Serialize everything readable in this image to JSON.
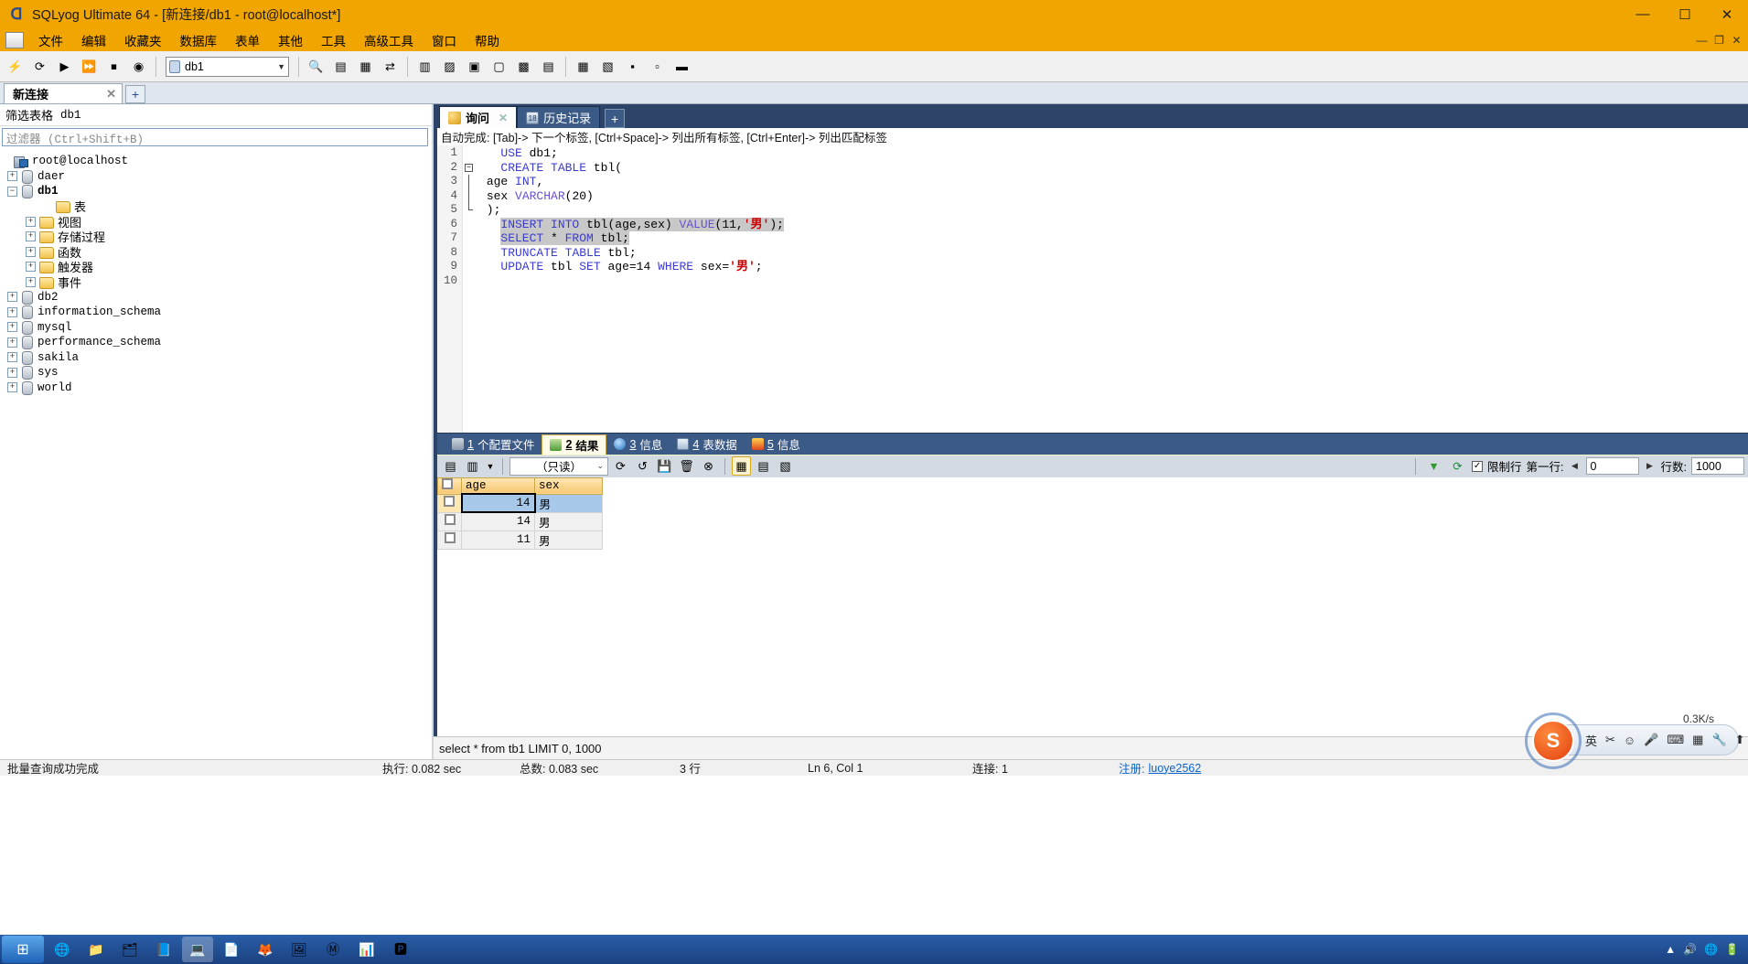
{
  "window": {
    "title": "SQLyog Ultimate 64 - [新连接/db1 - root@localhost*]",
    "minimize": "—",
    "maximize": "☐",
    "close": "✕"
  },
  "menubar": {
    "items": [
      "文件",
      "编辑",
      "收藏夹",
      "数据库",
      "表单",
      "其他",
      "工具",
      "高级工具",
      "窗口",
      "帮助"
    ],
    "mdi_minimize": "—",
    "mdi_restore": "❐",
    "mdi_close": "✕"
  },
  "toolbar": {
    "db_selector_value": "db1",
    "db_selector_arrow": "▼",
    "buttons": [
      {
        "name": "new-connection",
        "glyph": "⚡"
      },
      {
        "name": "refresh-object-browser",
        "glyph": "⟳"
      },
      {
        "name": "execute-query",
        "glyph": "▶"
      },
      {
        "name": "execute-all-queries",
        "glyph": "⏩"
      },
      {
        "name": "stop-query",
        "glyph": "⏹"
      },
      {
        "name": "firefox-like",
        "glyph": "◉"
      },
      {
        "name": "find",
        "glyph": "🔍"
      },
      {
        "name": "query-builder",
        "glyph": "▤"
      },
      {
        "name": "schema-designer",
        "glyph": "▦"
      },
      {
        "name": "data-sync",
        "glyph": "⇄"
      },
      {
        "name": "table-data",
        "glyph": "▥"
      },
      {
        "name": "table-diagnostics",
        "glyph": "▨"
      },
      {
        "name": "backup",
        "glyph": "▣"
      },
      {
        "name": "restore",
        "glyph": "▢"
      },
      {
        "name": "import-external",
        "glyph": "▩"
      },
      {
        "name": "export-csv",
        "glyph": "▤"
      },
      {
        "name": "scheduler",
        "glyph": "▦"
      },
      {
        "name": "user-manager",
        "glyph": "▧"
      },
      {
        "name": "preferences",
        "glyph": "▪"
      },
      {
        "name": "help-tools",
        "glyph": "▫"
      },
      {
        "name": "migration",
        "glyph": "▬"
      }
    ]
  },
  "connection_tabs": {
    "tabs": [
      {
        "label": "新连接",
        "close": "✕"
      }
    ],
    "add_label": "+"
  },
  "object_browser": {
    "filter_label": "筛选表格",
    "filter_db": "db1",
    "filter_placeholder": "过滤器 (Ctrl+Shift+B)",
    "tree": [
      {
        "label": "root@localhost",
        "icon": "server-icon",
        "indent": 0,
        "expander": "",
        "bold": false,
        "cjk": false
      },
      {
        "label": "daer",
        "icon": "database-icon",
        "indent": 1,
        "expander": "+",
        "bold": false,
        "cjk": false
      },
      {
        "label": "db1",
        "icon": "database-icon",
        "indent": 1,
        "expander": "−",
        "bold": true,
        "cjk": false
      },
      {
        "label": "表",
        "icon": "folder-icon",
        "indent": 3,
        "expander": "",
        "bold": false,
        "cjk": true
      },
      {
        "label": "视图",
        "icon": "folder-icon",
        "indent": 2,
        "expander": "+",
        "bold": false,
        "cjk": true
      },
      {
        "label": "存储过程",
        "icon": "folder-icon",
        "indent": 2,
        "expander": "+",
        "bold": false,
        "cjk": true
      },
      {
        "label": "函数",
        "icon": "folder-icon",
        "indent": 2,
        "expander": "+",
        "bold": false,
        "cjk": true
      },
      {
        "label": "触发器",
        "icon": "folder-icon",
        "indent": 2,
        "expander": "+",
        "bold": false,
        "cjk": true
      },
      {
        "label": "事件",
        "icon": "folder-icon",
        "indent": 2,
        "expander": "+",
        "bold": false,
        "cjk": true
      },
      {
        "label": "db2",
        "icon": "database-icon",
        "indent": 1,
        "expander": "+",
        "bold": false,
        "cjk": false
      },
      {
        "label": "information_schema",
        "icon": "database-icon",
        "indent": 1,
        "expander": "+",
        "bold": false,
        "cjk": false
      },
      {
        "label": "mysql",
        "icon": "database-icon",
        "indent": 1,
        "expander": "+",
        "bold": false,
        "cjk": false
      },
      {
        "label": "performance_schema",
        "icon": "database-icon",
        "indent": 1,
        "expander": "+",
        "bold": false,
        "cjk": false
      },
      {
        "label": "sakila",
        "icon": "database-icon",
        "indent": 1,
        "expander": "+",
        "bold": false,
        "cjk": false
      },
      {
        "label": "sys",
        "icon": "database-icon",
        "indent": 1,
        "expander": "+",
        "bold": false,
        "cjk": false
      },
      {
        "label": "world",
        "icon": "database-icon",
        "indent": 1,
        "expander": "+",
        "bold": false,
        "cjk": false
      }
    ]
  },
  "query_tabs": {
    "tabs": [
      {
        "label": "询问",
        "icon": "pencil-icon",
        "active": true,
        "close": "✕"
      },
      {
        "label": "历史记录",
        "icon": "history-icon",
        "active": false,
        "badge": "18"
      }
    ],
    "add_label": "+"
  },
  "editor": {
    "autocomplete_hint": "自动完成: [Tab]-> 下一个标签, [Ctrl+Space]-> 列出所有标签, [Ctrl+Enter]-> 列出匹配标签",
    "line_numbers": [
      "1",
      "2",
      "3",
      "4",
      "5",
      "6",
      "7",
      "8",
      "9",
      "10"
    ],
    "lines": [
      {
        "n": 1,
        "text": "USE db1;"
      },
      {
        "n": 2,
        "text": "CREATE TABLE tbl("
      },
      {
        "n": 3,
        "text": "age INT,"
      },
      {
        "n": 4,
        "text": "sex VARCHAR(20)"
      },
      {
        "n": 5,
        "text": ");"
      },
      {
        "n": 6,
        "text": "INSERT INTO tbl(age,sex) VALUE(11,'男');"
      },
      {
        "n": 7,
        "text": "SELECT * FROM tbl;"
      },
      {
        "n": 8,
        "text": "TRUNCATE TABLE tbl;"
      },
      {
        "n": 9,
        "text": "UPDATE tbl SET age=14 WHERE sex='男';"
      },
      {
        "n": 10,
        "text": ""
      }
    ]
  },
  "result_tabs": [
    {
      "num": "1",
      "label": "个配置文件",
      "icon": "profile-icon",
      "active": false
    },
    {
      "num": "2",
      "label": "结果",
      "icon": "result-icon",
      "active": true
    },
    {
      "num": "3",
      "label": "信息",
      "icon": "info-icon",
      "active": false
    },
    {
      "num": "4",
      "label": "表数据",
      "icon": "table-data-icon",
      "active": false
    },
    {
      "num": "5",
      "label": "信息",
      "icon": "messages-icon",
      "active": false
    }
  ],
  "grid_toolbar": {
    "mode_value": "（只读）",
    "mode_arrow": "⌄",
    "dropdown_arrow": "▼",
    "limit_checkbox": "✓",
    "limit_label": "限制行",
    "first_row_label": "第一行:",
    "first_row_value": "0",
    "rows_label": "行数:",
    "rows_value": "1000",
    "prev_arrow": "◀",
    "next_arrow": "▶",
    "buttons": [
      {
        "name": "grid-insert-row",
        "glyph": "▤"
      },
      {
        "name": "grid-duplicate-row",
        "glyph": "▥"
      },
      {
        "name": "grid-refresh-data",
        "glyph": "⟳"
      },
      {
        "name": "grid-revert-changes",
        "glyph": "↺"
      },
      {
        "name": "grid-save-changes",
        "glyph": "💾"
      },
      {
        "name": "grid-delete-row",
        "glyph": "🗑"
      },
      {
        "name": "grid-delete-all",
        "glyph": "⊗"
      },
      {
        "name": "view-grid",
        "glyph": "▦"
      },
      {
        "name": "view-form",
        "glyph": "▤"
      },
      {
        "name": "view-text",
        "glyph": "▧"
      }
    ],
    "filter_icon": "filter-icon",
    "refresh_icon": "refresh-icon"
  },
  "result_grid": {
    "columns": [
      "age",
      "sex"
    ],
    "rows": [
      {
        "age": "14",
        "sex": "男",
        "selected": true
      },
      {
        "age": "14",
        "sex": "男",
        "selected": false
      },
      {
        "age": "11",
        "sex": "男",
        "selected": false
      }
    ]
  },
  "query_status": {
    "text": "select * from tb1 LIMIT 0, 1000"
  },
  "statusbar": {
    "message": "批量查询成功完成",
    "exec_time": "执行: 0.082 sec",
    "total_time": "总数: 0.083 sec",
    "rows": "3 行",
    "cursor": "Ln 6, Col 1",
    "connection": "连接: 1",
    "register_label": "注册:",
    "register_user": "luoye2562"
  },
  "ime": {
    "mode": "英",
    "speed": "0.3K/s",
    "items": [
      "英",
      "✂",
      "☺",
      "🎤",
      "⌨",
      "▦",
      "🔧",
      "⬆",
      "▤"
    ]
  },
  "taskbar": {
    "start": "⊞",
    "buttons": [
      "🌐",
      "📁",
      "🗂",
      "📘",
      "💻",
      "📄",
      "🦊",
      "🖼",
      "Ⓜ",
      "📊",
      "🅿"
    ],
    "tray": [
      "▲",
      "🔊",
      "🌐",
      "🔋"
    ]
  },
  "colors": {
    "titlebar": "#f0a500",
    "panel_blue": "#3c5a86",
    "accent_tab": "#fffbe8",
    "keyword": "#3b3bd0",
    "string": "#cc0000"
  }
}
